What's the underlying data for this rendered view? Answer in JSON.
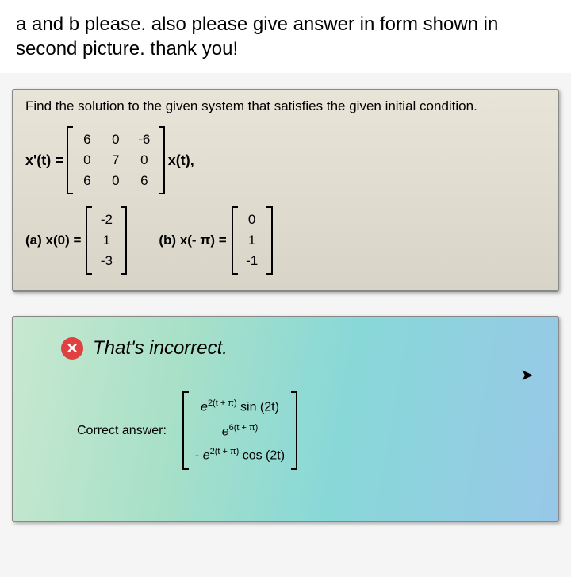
{
  "header": {
    "line": "a and b please. also please give answer in form shown in second picture. thank you!"
  },
  "problem": {
    "statement": "Find the solution to the given system that satisfies the given initial condition.",
    "eq_lhs": "x'(t) =",
    "eq_rhs": "x(t),",
    "matrix_A": [
      [
        "6",
        "0",
        "-6"
      ],
      [
        "0",
        "7",
        "0"
      ],
      [
        "6",
        "0",
        "6"
      ]
    ],
    "cond_a": {
      "label": "(a) x(0) =",
      "vec": [
        "-2",
        "1",
        "-3"
      ]
    },
    "cond_b": {
      "label": "(b) x(- π) =",
      "vec": [
        "0",
        "1",
        "-1"
      ]
    }
  },
  "feedback": {
    "incorrect_text": "That's incorrect.",
    "correct_label": "Correct answer:",
    "answer": {
      "rows": [
        {
          "prefix": "",
          "exp": "2(t + π)",
          "trig": " sin (2t)"
        },
        {
          "prefix": "",
          "exp": "6(t + π)",
          "trig": ""
        },
        {
          "prefix": "- ",
          "exp": "2(t + π)",
          "trig": " cos (2t)"
        }
      ]
    }
  }
}
